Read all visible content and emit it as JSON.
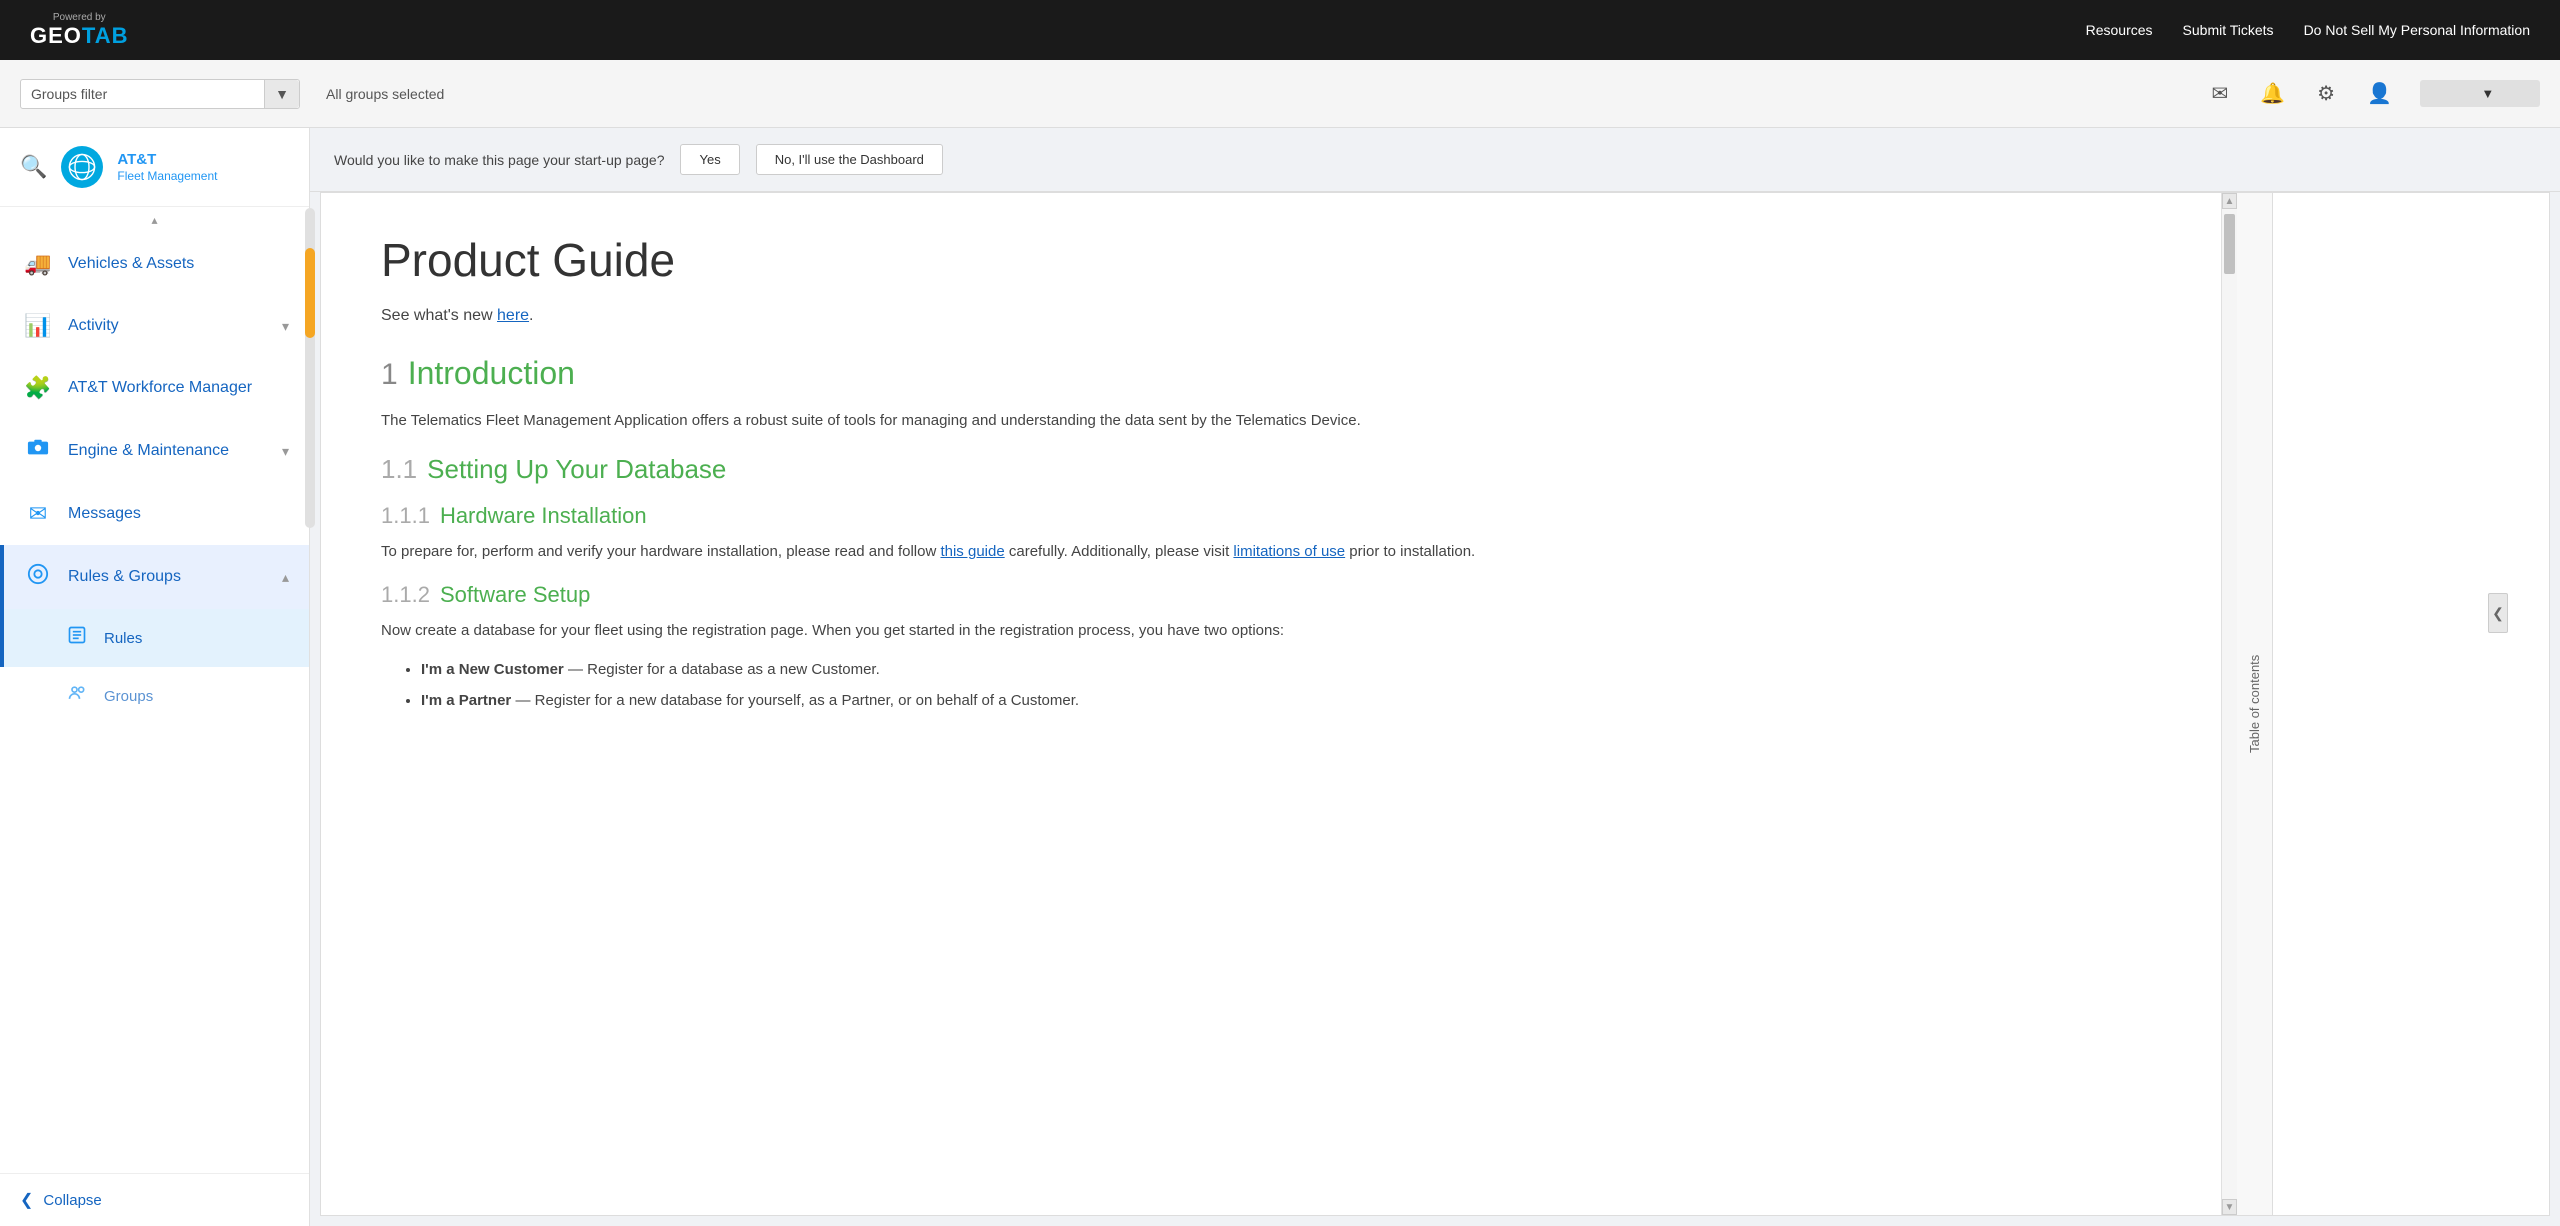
{
  "topbar": {
    "powered_by": "Powered by",
    "brand_geo": "GEO",
    "brand_tab": "TAB",
    "nav_links": [
      "Resources",
      "Submit Tickets",
      "Do Not Sell My Personal Information"
    ]
  },
  "filterbar": {
    "groups_filter_label": "Groups filter",
    "all_groups_text": "All groups selected",
    "dropdown_arrow": "▼"
  },
  "icons": {
    "mail": "✉",
    "bell": "🔔",
    "gear": "⚙",
    "user": "👤",
    "search": "🔍",
    "chevron_down": "▾",
    "chevron_up": "▴",
    "collapse_left": "❮",
    "collapse_right": "❯"
  },
  "sidebar": {
    "logo_att": "AT&T",
    "logo_sub": "Fleet Management",
    "nav_items": [
      {
        "id": "vehicles",
        "label": "Vehicles & Assets",
        "icon": "🚚",
        "has_sub": false
      },
      {
        "id": "activity",
        "label": "Activity",
        "icon": "📊",
        "has_sub": true,
        "expanded": false
      },
      {
        "id": "att-workforce",
        "label": "AT&T Workforce Manager",
        "icon": "🧩",
        "has_sub": false
      },
      {
        "id": "engine",
        "label": "Engine & Maintenance",
        "icon": "🎥",
        "has_sub": true,
        "expanded": false
      },
      {
        "id": "messages",
        "label": "Messages",
        "icon": "✉",
        "has_sub": false
      },
      {
        "id": "rules-groups",
        "label": "Rules & Groups",
        "icon": "⊙",
        "has_sub": true,
        "expanded": true
      }
    ],
    "sub_items": [
      {
        "id": "rules",
        "label": "Rules",
        "icon": "📋",
        "parent": "rules-groups",
        "active": true
      },
      {
        "id": "groups",
        "label": "Groups",
        "icon": "👥",
        "parent": "rules-groups",
        "active": false
      }
    ],
    "collapse_label": "Collapse"
  },
  "startup_banner": {
    "question": "Would you like to make this page your start-up page?",
    "yes_label": "Yes",
    "no_label": "No, I'll use the Dashboard"
  },
  "guide": {
    "title": "Product Guide",
    "intro_text": "See what's new ",
    "intro_link": "here",
    "intro_period": ".",
    "sections": [
      {
        "num": "1",
        "title": "Introduction",
        "body": "The Telematics Fleet Management Application offers a robust suite of tools for managing and understanding the data sent by the Telematics Device.",
        "subsections": [
          {
            "num": "1.1",
            "title": "Setting Up Your Database",
            "sub_subsections": [
              {
                "num": "1.1.1",
                "title": "Hardware Installation",
                "body_prefix": "To prepare for, perform and verify your hardware installation, please read and follow ",
                "link1_text": "this guide",
                "body_mid": " carefully. Additionally, please visit ",
                "link2_text": "limitations of use",
                "body_suffix": " prior to installation."
              },
              {
                "num": "1.1.2",
                "title": "Software Setup",
                "body": "Now create a database for your fleet using the registration page. When you get started in the registration process, you have two options:",
                "bullets": [
                  {
                    "bold": "I'm a New Customer",
                    "rest": " — Register for a database as a new Customer."
                  },
                  {
                    "bold": "I'm a Partner",
                    "rest": " — Register for a new database for yourself, as a Partner, or on behalf of a Customer."
                  }
                ]
              }
            ]
          }
        ]
      }
    ],
    "toc_label": "Table of contents"
  },
  "user_dropdown": {
    "label": ""
  }
}
